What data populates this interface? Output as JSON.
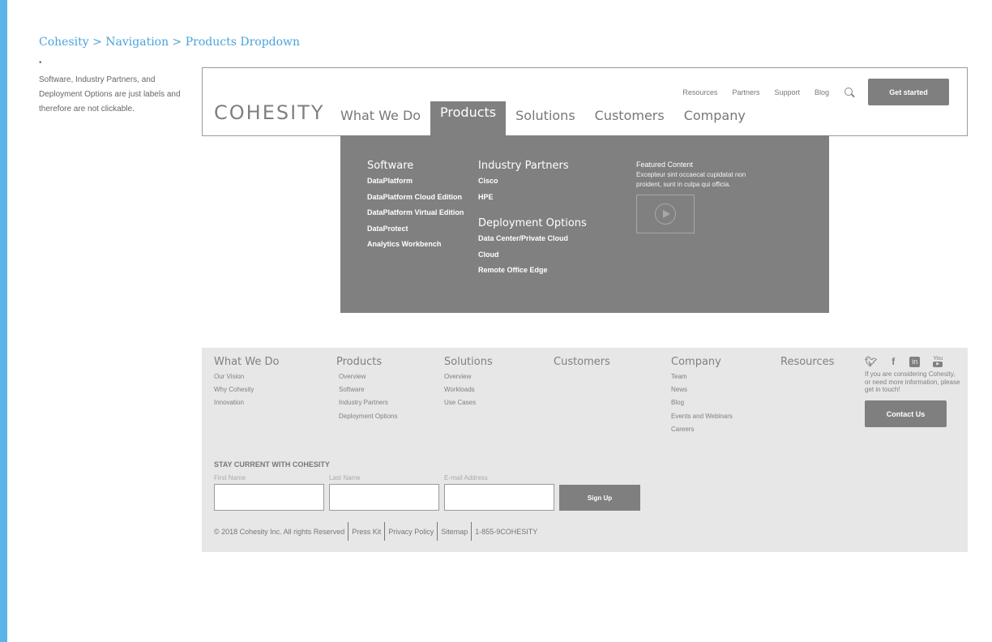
{
  "breadcrumb": "Cohesity > Navigation > Products Dropdown",
  "note": {
    "bullet": "•",
    "text": "Software, Industry Partners, and Deployment Options are just labels and therefore are not clickable."
  },
  "header": {
    "logo": "COHESITY",
    "nav": [
      "What We Do",
      "Products",
      "Solutions",
      "Customers",
      "Company"
    ],
    "active_nav": "Products",
    "utility": [
      "Resources",
      "Partners",
      "Support",
      "Blog"
    ],
    "get_started": "Get started"
  },
  "dropdown": {
    "software": {
      "heading": "Software",
      "items": [
        "DataPlatform",
        "DataPlatform Cloud Edition",
        "DataPlatform Virtual Edition",
        "DataProtect",
        "Analytics Workbench"
      ]
    },
    "partners": {
      "heading": "Industry Partners",
      "items": [
        "Cisco",
        "HPE"
      ]
    },
    "deployment": {
      "heading": "Deployment Options",
      "items": [
        "Data Center/Private Cloud",
        "Cloud",
        "Remote Office Edge"
      ]
    },
    "featured": {
      "title": "Featured Content",
      "text": "Excepteur sint occaecat cupidatat non proident, sunt in culpa qui officia."
    }
  },
  "footer": {
    "columns": [
      {
        "heading": "What We Do",
        "links": [
          "Our Vision",
          "Why Cohesity",
          "Innovation"
        ]
      },
      {
        "heading": "Products",
        "links": [
          "Overview",
          "Software",
          "Industry Partners",
          "Deployment Options"
        ]
      },
      {
        "heading": "Solutions",
        "links": [
          "Overview",
          "Workloads",
          "Use Cases"
        ]
      },
      {
        "heading": "Customers",
        "links": []
      },
      {
        "heading": "Company",
        "links": [
          "Team",
          "News",
          "Blog",
          "Events and Webinars",
          "Careers"
        ]
      },
      {
        "heading": "Resources",
        "links": []
      }
    ],
    "social_icons": [
      "twitter-icon",
      "facebook-icon",
      "linkedin-icon",
      "youtube-icon"
    ],
    "consider_text": "If you are considering Cohesity, or need more information, please get in touch!",
    "contact_us": "Contact Us",
    "newsletter": {
      "heading": "STAY CURRENT WITH COHESITY",
      "first_name_label": "First Name",
      "last_name_label": "Last Name",
      "email_label": "E-mail Address",
      "sign_up": "Sign Up"
    },
    "legal": {
      "copyright": "© 2018 Cohesity Inc. All rights Reserved",
      "press_kit": "Press Kit",
      "privacy": "Privacy Policy",
      "sitemap": "Sitemap",
      "phone": "1-855-9COHESITY"
    }
  },
  "colors": {
    "accent": "#5ab4ea",
    "breadcrumb": "#4aa3d9",
    "dropdown_bg": "#808080",
    "footer_bg": "#e7e7e7"
  }
}
